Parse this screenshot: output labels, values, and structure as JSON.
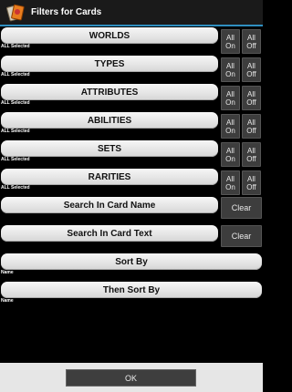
{
  "app": {
    "title": "Filters for Cards",
    "icon": "cards-app-icon"
  },
  "filters": [
    {
      "label": "WORLDS",
      "status": "ALL Selected",
      "on": [
        "All",
        "On"
      ],
      "off": [
        "All",
        "Off"
      ]
    },
    {
      "label": "TYPES",
      "status": "ALL Selected",
      "on": [
        "All",
        "On"
      ],
      "off": [
        "All",
        "Off"
      ]
    },
    {
      "label": "ATTRIBUTES",
      "status": "ALL Selected",
      "on": [
        "All",
        "On"
      ],
      "off": [
        "All",
        "Off"
      ]
    },
    {
      "label": "ABILITIES",
      "status": "ALL Selected",
      "on": [
        "All",
        "On"
      ],
      "off": [
        "All",
        "Off"
      ]
    },
    {
      "label": "SETS",
      "status": "ALL Selected",
      "on": [
        "All",
        "On"
      ],
      "off": [
        "All",
        "Off"
      ]
    },
    {
      "label": "RARITIES",
      "status": "ALL Selected",
      "on": [
        "All",
        "On"
      ],
      "off": [
        "All",
        "Off"
      ]
    }
  ],
  "search": [
    {
      "label": "Search In Card Name",
      "clear": "Clear"
    },
    {
      "label": "Search In Card Text",
      "clear": "Clear"
    }
  ],
  "sort": [
    {
      "label": "Sort By",
      "value": "Name"
    },
    {
      "label": "Then Sort By",
      "value": "Name"
    }
  ],
  "footer": {
    "ok_label": "OK"
  },
  "colors": {
    "accent": "#2f8fc0",
    "background": "#000000"
  }
}
